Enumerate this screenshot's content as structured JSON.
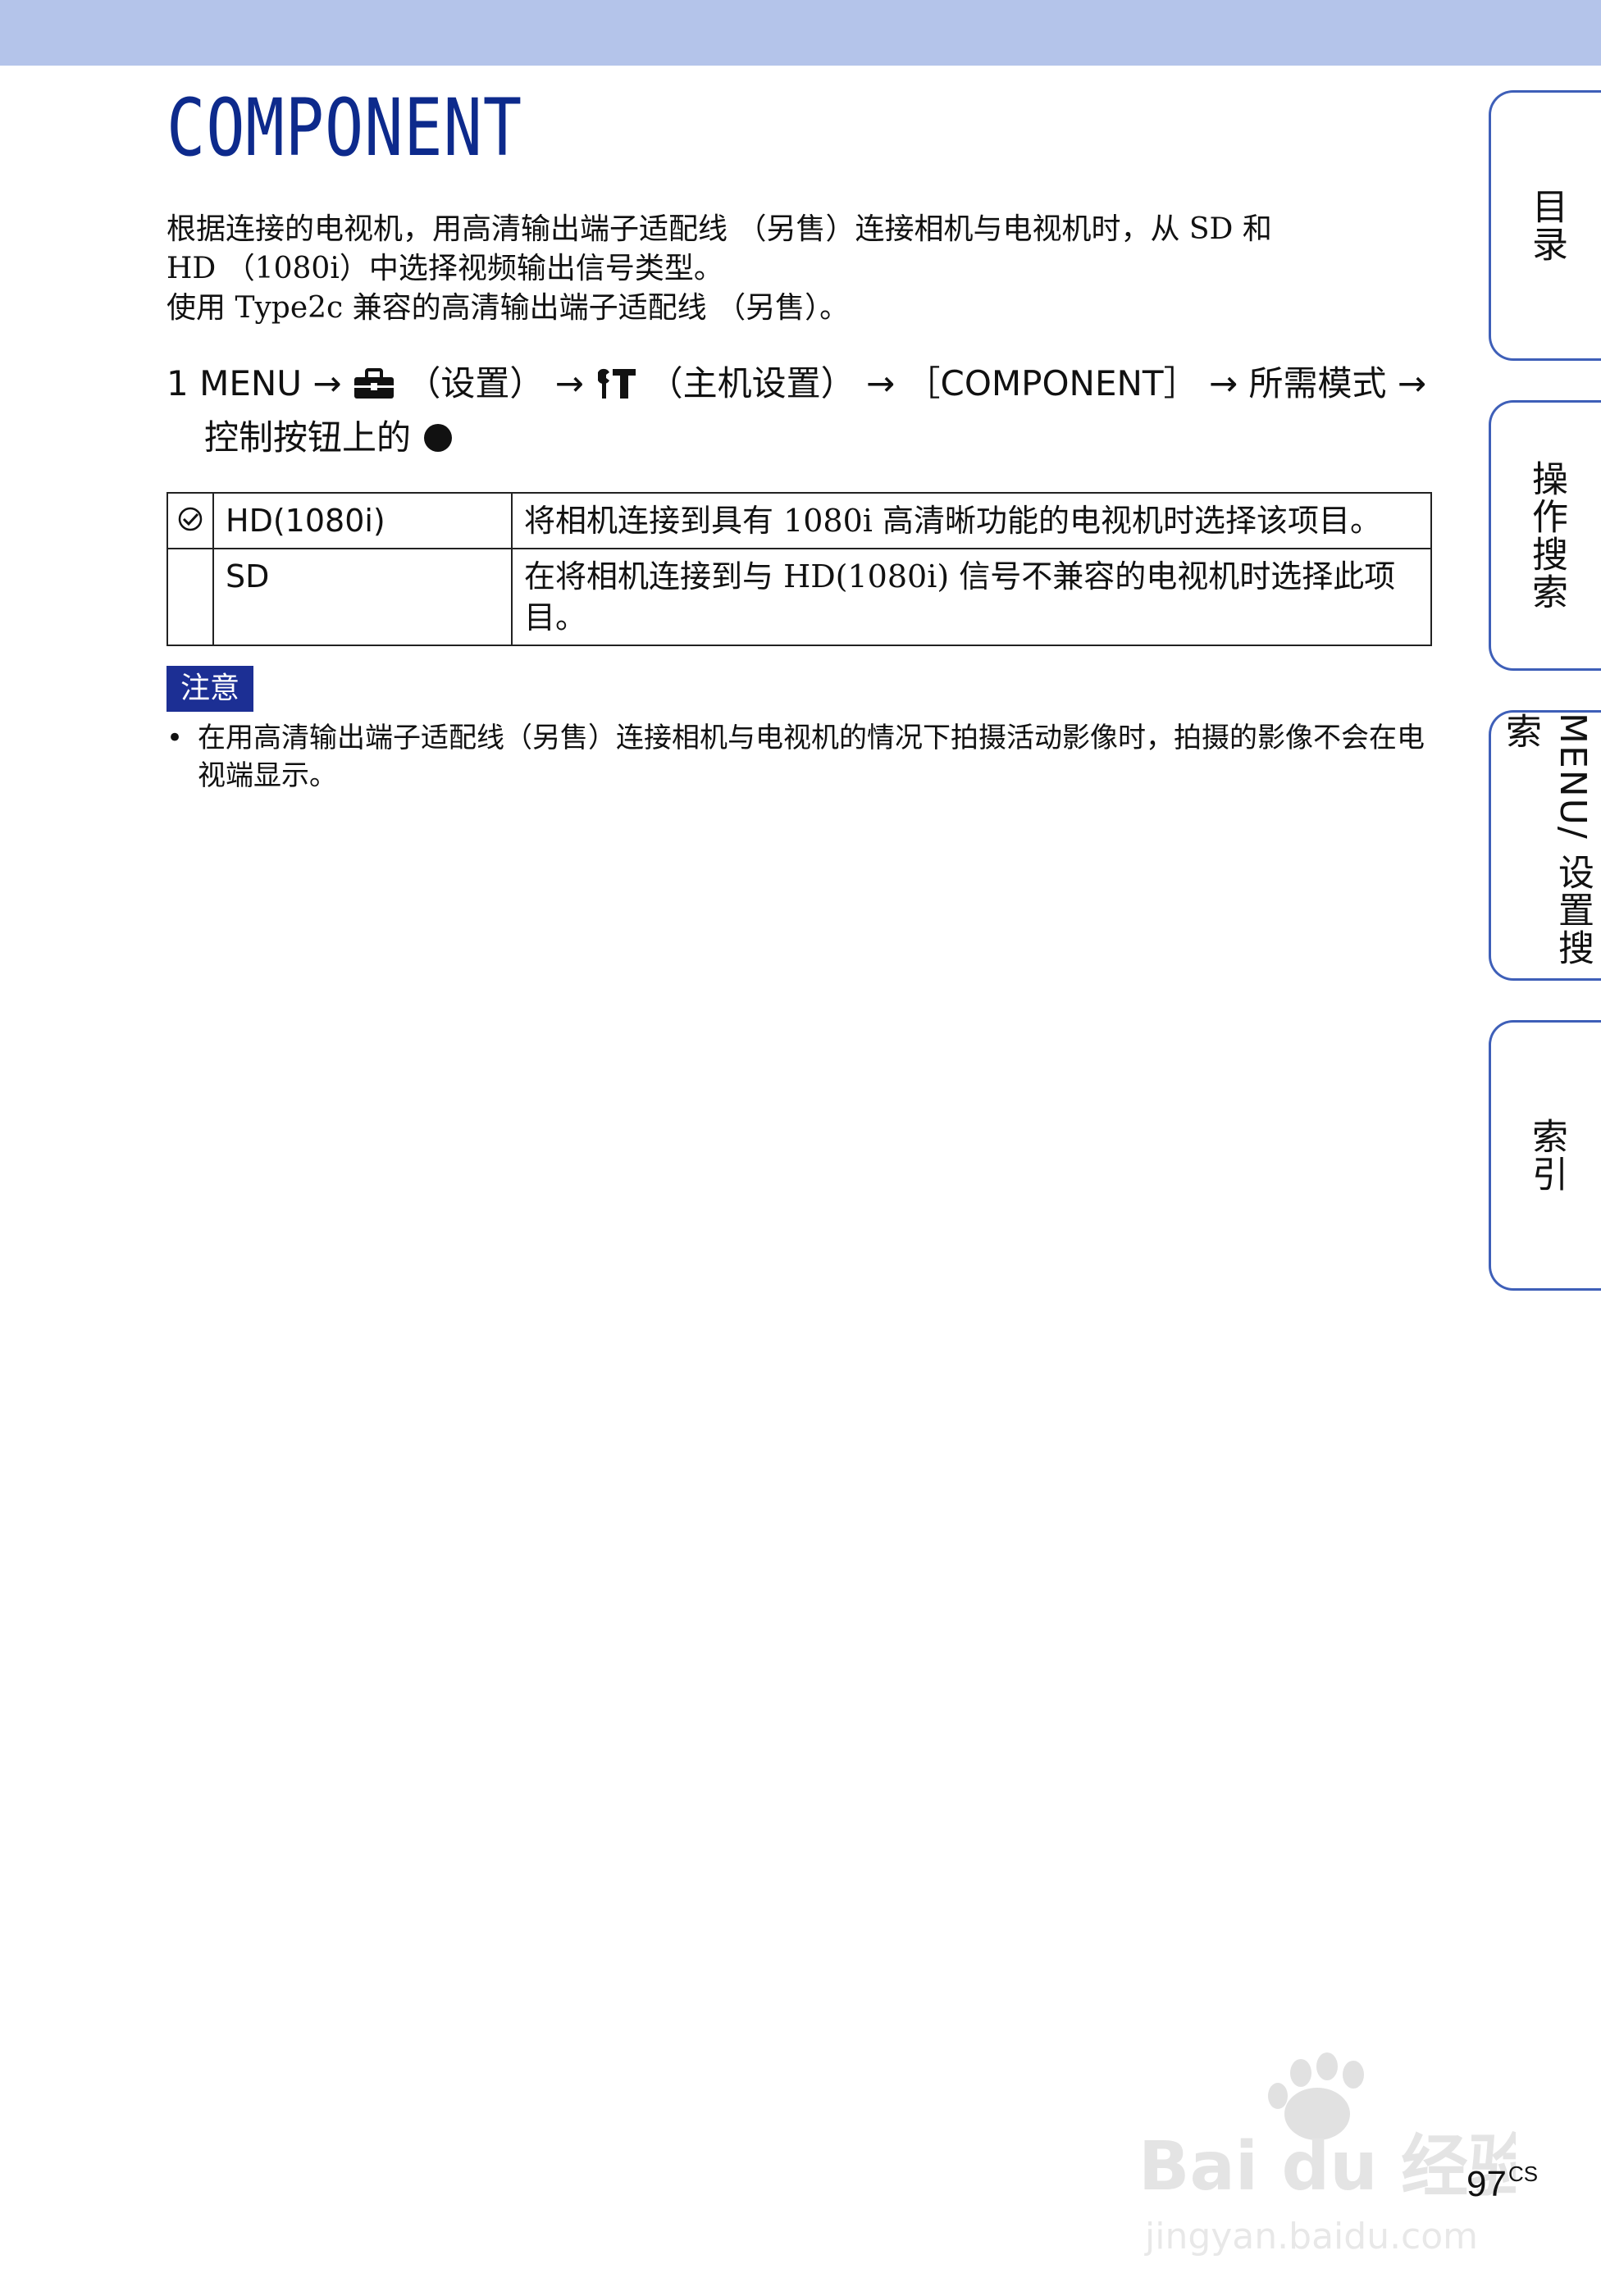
{
  "page": {
    "title": "COMPONENT",
    "accent_color": "#0d2a8c",
    "band_color": "#b4c4ea"
  },
  "intro": {
    "line1": "根据连接的电视机，用高清输出端子适配线 （另售）连接相机与电视机时，从 SD 和",
    "line2": "HD （1080i）中选择视频输出信号类型。",
    "line3": "使用 Type2c 兼容的高清输出端子适配线 （另售）。"
  },
  "step": {
    "number": "1",
    "menu": "MENU",
    "arrow": "→",
    "setup_icon": "toolbox-icon",
    "setup_label": "（设置）",
    "main_setup_icon": "wrench-icon",
    "main_setup_label": "（主机设置）",
    "item": "［COMPONENT］",
    "mode": "所需模式",
    "line2": "控制按钮上的",
    "confirm_icon": "filled-circle-icon"
  },
  "modes": [
    {
      "default": true,
      "name": "HD(1080i)",
      "desc": "将相机连接到具有 1080i 高清晰功能的电视机时选择该项目。"
    },
    {
      "default": false,
      "name": "SD",
      "desc": "在将相机连接到与 HD(1080i) 信号不兼容的电视机时选择此项目。"
    }
  ],
  "note": {
    "label": "注意",
    "items": [
      "在用高清输出端子适配线（另售）连接相机与电视机的情况下拍摄活动影像时，拍摄的影像不会在电视端显示。"
    ]
  },
  "side_tabs": [
    {
      "label": "目录"
    },
    {
      "label": "操作搜索"
    },
    {
      "label": "MENU/ 设置搜索"
    },
    {
      "label": "索引"
    }
  ],
  "footer": {
    "page_number": "97",
    "page_suffix": "CS"
  },
  "watermark": {
    "brand": "Bai du 经验",
    "url": "jingyan.baidu.com"
  }
}
